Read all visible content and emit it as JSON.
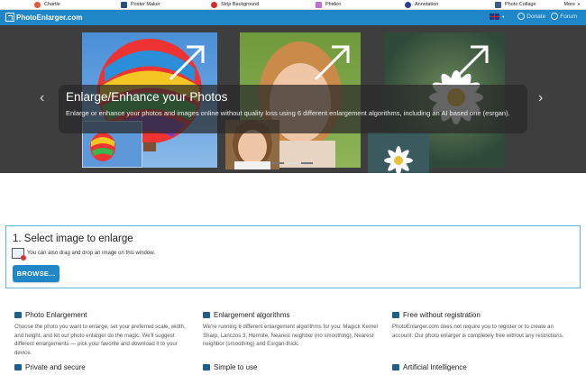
{
  "topbar": {
    "apps": [
      {
        "label": "Chartle",
        "icon": "chartle-icon",
        "color": "#e8573a"
      },
      {
        "label": "Poster Maker",
        "icon": "poster-maker-icon",
        "color": "#2a4d7a"
      },
      {
        "label": "Strip Background",
        "icon": "strip-background-icon",
        "color": "#d42c2c"
      },
      {
        "label": "Phideo",
        "icon": "phideo-icon",
        "color": "#c06bd6"
      },
      {
        "label": "Annotation",
        "icon": "annotation-icon",
        "color": "#2a3f9a"
      },
      {
        "label": "Photo Collage",
        "icon": "photo-collage-icon",
        "color": "#3a5b8c"
      }
    ],
    "more_label": "More"
  },
  "header": {
    "brand": "PhotoEnlarger.com",
    "donate": "Donate",
    "forum": "Forum",
    "accent": "#1f86c7"
  },
  "hero": {
    "title": "Enlarge/Enhance your Photos",
    "subtitle": "Enlarge or enhance your photos and images online without quality loss using 6 different enlargement algorithms, including an AI based one (esrgan)."
  },
  "select": {
    "heading": "1. Select image to enlarge",
    "drag_hint": "You can also drag and drop an image on this window.",
    "browse_label": "BROWSE..."
  },
  "features": [
    {
      "title": "Photo Enlargement",
      "icon": "photo-icon",
      "text": "Choose the photo you want to enlarge, set your preferred scale, width, and height, and let our photo enlarger do the magic. We'll suggest different enlargements — pick your favorite and download it to your device."
    },
    {
      "title": "Enlargement algorithms",
      "icon": "algorithms-icon",
      "text": "We're running 6 different enlargement algorithms for you: Magick Kernel Sharp, Lanczos 3, Hermite, Nearest neighbor (no smoothing), Nearest neighbor (smoothing) and Esrgan-thick."
    },
    {
      "title": "Free without registration",
      "icon": "user-icon",
      "text": "PhotoEnlarger.com does not require you to register or to create an account. Our photo enlarger is completely free without any restrictions."
    },
    {
      "title": "Private and secure",
      "icon": "lock-icon",
      "text": ""
    },
    {
      "title": "Simple to use",
      "icon": "simple-icon",
      "text": ""
    },
    {
      "title": "Artificial Intelligence",
      "icon": "ai-icon",
      "text": ""
    }
  ]
}
